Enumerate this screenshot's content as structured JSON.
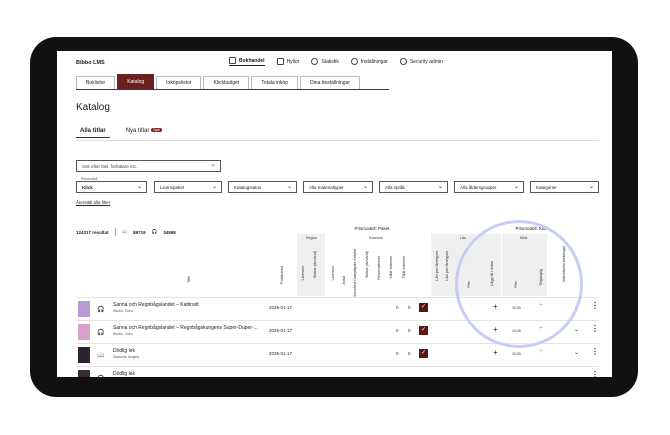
{
  "brand": "Bibbo LMS",
  "topnav": [
    {
      "label": "Bokhandel",
      "icon": "store-icon",
      "active": true
    },
    {
      "label": "Hyllor",
      "icon": "shelves-icon",
      "active": false
    },
    {
      "label": "Statistik",
      "icon": "statistics-icon",
      "active": false
    },
    {
      "label": "Inställningar",
      "icon": "gear-icon",
      "active": false
    },
    {
      "label": "Security admin",
      "icon": "security-icon",
      "active": false
    }
  ],
  "tabs": [
    "Boklistor",
    "Katalog",
    "Inköpslistor",
    "Klickbudget",
    "Totala inköp",
    "Dina beställningar"
  ],
  "active_tab": "Katalog",
  "page_title": "Katalog",
  "subtabs": [
    {
      "label": "Alla titlar",
      "active": true
    },
    {
      "label": "Nya titlar",
      "active": false,
      "badge": "Nytt"
    }
  ],
  "search_placeholder": "Sök efter titel, författare etc.",
  "filters": [
    {
      "label": "Prismodell",
      "value": "Klick"
    },
    {
      "label": "",
      "value": "Licenspaket"
    },
    {
      "label": "",
      "value": "Katalogstatus"
    },
    {
      "label": "",
      "value": "Alla materialtyper"
    },
    {
      "label": "",
      "value": "Alla språk"
    },
    {
      "label": "",
      "value": "Alla åldersgrupper"
    },
    {
      "label": "",
      "value": "Kategorier"
    }
  ],
  "reset_label": "Återställ alla filter",
  "results": {
    "total": "124317 resultat",
    "ebooks": "89719",
    "audiobooks": "34598"
  },
  "headers": {
    "paket": "Prismodell: Paket",
    "klick": "Prismodell: Klick",
    "region": "Region",
    "kommun": "Kommun",
    "lan": "Lån",
    "klick_sub": "Klick",
    "title": "Titel",
    "published": "Publicerad",
    "region_cols": [
      "Licenser",
      "Status (Använd)"
    ],
    "kommun_cols": [
      "Licenser",
      "Antal",
      "Oanvänd Outnyttjade Antalet",
      "Status (Använd)",
      "Reservationer",
      "Villat Intresse",
      "Tillåt Intresse"
    ],
    "lan_cols": [
      "Lån per lånetyper",
      "Lån per lånetyper",
      "Pris",
      "Lägg till i listan"
    ],
    "klick_cols": [
      "Pris",
      "Tillgänglig"
    ],
    "last_col": "Individuella ändringar"
  },
  "rows": [
    {
      "title": "Sanna och Regnbågslandet – Kattinatt",
      "author": "Studio, Guru",
      "type": "audiobook",
      "date": "2025-01-17",
      "n1": "0",
      "n2": "0",
      "price": "10,00",
      "cover": "#b79ad6"
    },
    {
      "title": "Sanna och Regnbågslandet – Regnbågskungens Super-Duper-...",
      "author": "Studio, Guru",
      "type": "audiobook",
      "date": "2025-01-17",
      "n1": "0",
      "n2": "0",
      "price": "10,00",
      "cover": "#d8a0c8"
    },
    {
      "title": "Dödlig lek",
      "author": "Marsons, Angela",
      "type": "ebook",
      "date": "2025-01-17",
      "n1": "0",
      "n2": "0",
      "price": "10,00",
      "cover": "#2b2430"
    },
    {
      "title": "Dödlig lek",
      "author": "",
      "type": "audiobook",
      "date": "",
      "n1": "",
      "n2": "",
      "price": "",
      "cover": "#3a2d2d"
    }
  ]
}
